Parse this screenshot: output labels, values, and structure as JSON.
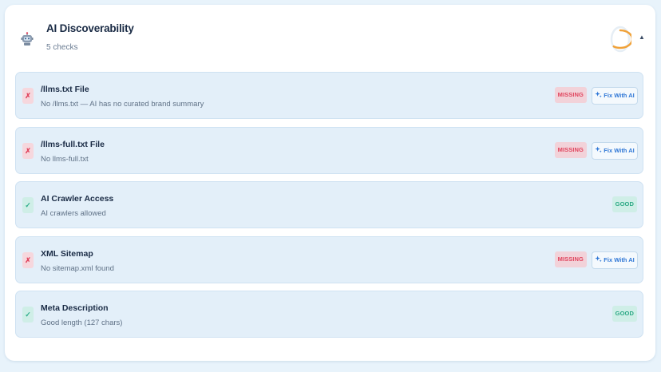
{
  "section": {
    "title": "AI Discoverability",
    "subtitle": "5 checks",
    "progress": 0.6,
    "colors": {
      "accent": "#f0a23a",
      "track": "#e6eef5"
    }
  },
  "checks": [
    {
      "title": "/llms.txt File",
      "description": "No /llms.txt — AI has no curated brand summary",
      "status": "fail",
      "status_icon": "✗",
      "badge": "MISSING",
      "action_label": "Fix With AI"
    },
    {
      "title": "/llms-full.txt File",
      "description": "No llms-full.txt",
      "status": "fail",
      "status_icon": "✗",
      "badge": "MISSING",
      "action_label": "Fix With AI"
    },
    {
      "title": "AI Crawler Access",
      "description": "AI crawlers allowed",
      "status": "pass",
      "status_icon": "✓",
      "badge": "GOOD"
    },
    {
      "title": "XML Sitemap",
      "description": "No sitemap.xml found",
      "status": "fail",
      "status_icon": "✗",
      "badge": "MISSING",
      "action_label": "Fix With AI"
    },
    {
      "title": "Meta Description",
      "description": "Good length (127 chars)",
      "status": "pass",
      "status_icon": "✓",
      "badge": "GOOD"
    }
  ],
  "icons": {
    "section": "robot-icon",
    "collapse": "chevron-up-icon",
    "action": "sparkle-icon"
  }
}
